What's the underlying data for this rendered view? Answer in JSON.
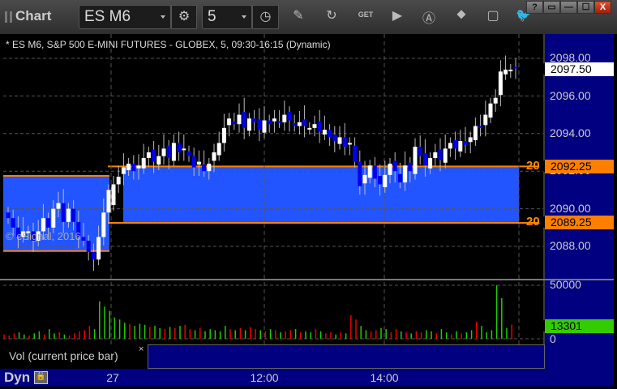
{
  "titlebar": {
    "title": "Chart",
    "symbol": "ES M6",
    "interval": "5",
    "tools": [
      "gear-icon",
      "clock-icon",
      "pencil-icon",
      "refresh-chart-icon",
      "get-icon",
      "play-icon",
      "a-circle-icon",
      "link-icon",
      "comment-icon",
      "twitter-icon"
    ],
    "window_buttons": [
      "?",
      "▭",
      "—",
      "☐",
      "X"
    ]
  },
  "chart": {
    "header": "* ES M6, S&P 500 E-MINI FUTURES - GLOBEX, 5, 09:30-16:15 (Dynamic)",
    "copyright": "© eSignal, 2016",
    "price_labels": [
      "2098.00",
      "2096.00",
      "2094.00",
      "2092.00",
      "2090.00",
      "2088.00"
    ],
    "last_price": "2097.50",
    "level_high": "2092.25",
    "level_low": "2089.25",
    "level_cut_label": "20",
    "colors": {
      "up": "#ffffff",
      "down": "#0000ee",
      "range_fill": "#2255ff",
      "level": "#ff8000",
      "axis": "#000080",
      "vol_up": "#22cc00",
      "vol_down": "#ee0000"
    },
    "prev_day_range": [
      2087.75,
      2091.75
    ],
    "prev_day_closes": [
      2089.5,
      2089,
      2088.5,
      2088.8,
      2088.8,
      2088.3,
      2088.8,
      2089.5,
      2089,
      2090,
      2090.3,
      2089.3,
      2090,
      2089.3,
      2088.5,
      2088.3,
      2087.7,
      2087.3,
      2088.5,
      2089.8,
      2091
    ],
    "day_closes": [
      2091.3,
      2091.7,
      2092.2,
      2092.4,
      2092.0,
      2092.3,
      2092.7,
      2093.0,
      2092.5,
      2092.8,
      2093.2,
      2092.7,
      2093.5,
      2093.0,
      2093.2,
      2092.8,
      2092.2,
      2092.5,
      2092.0,
      2092.4,
      2093.0,
      2093.5,
      2094.3,
      2094.8,
      2094.5,
      2095.0,
      2094.3,
      2094.8,
      2094.6,
      2094.2,
      2094.7,
      2094.5,
      2094.8,
      2094.6,
      2095.0,
      2094.7,
      2094.4,
      2094.6,
      2094.4,
      2094.3,
      2094.5,
      2094.1,
      2094.2,
      2093.8,
      2093.6,
      2093.8,
      2093.3,
      2093.5,
      2092.5,
      2091.2,
      2091.8,
      2092.3,
      2091.6,
      2091.3,
      2091.8,
      2092.4,
      2092.0,
      2091.4,
      2092.3,
      2092.0,
      2093.3,
      2092.8,
      2092.3,
      2092.7,
      2093.0,
      2092.6,
      2093.2,
      2093.5,
      2093.2,
      2093.6,
      2093.4,
      2093.8,
      2094.4,
      2094.3,
      2095.0,
      2095.6,
      2095.9,
      2097.3,
      2097.4,
      2097.4,
      2097.5
    ]
  },
  "volume": {
    "label": "Vol (current price bar)",
    "close_label": "×",
    "scale_labels": [
      "50000",
      "0"
    ],
    "last": "13301",
    "values": [
      4000,
      3000,
      5000,
      6000,
      4000,
      3000,
      5000,
      7000,
      4000,
      9000,
      5000,
      6000,
      4000,
      3000,
      5000,
      7000,
      8000,
      12000,
      9000,
      35000,
      30000,
      26000,
      20000,
      18000,
      15000,
      14000,
      12000,
      14000,
      13000,
      11000,
      12000,
      10000,
      9000,
      11000,
      10000,
      12000,
      13000,
      9000,
      8000,
      10000,
      7000,
      9000,
      8000,
      7000,
      12000,
      9000,
      8000,
      10000,
      8000,
      11000,
      9000,
      8000,
      7000,
      9000,
      8000,
      6000,
      7000,
      8000,
      9000,
      6000,
      7000,
      6000,
      9000,
      7000,
      5000,
      6000,
      4000,
      6000,
      5000,
      22000,
      18000,
      12000,
      8000,
      7000,
      8000,
      10000,
      9000,
      6000,
      9000,
      7000,
      6000,
      5000,
      7000,
      6000,
      8000,
      7000,
      5000,
      9000,
      6000,
      4000,
      7000,
      5000,
      6000,
      8000,
      16000,
      12000,
      6000,
      8000,
      50000,
      38000,
      10000,
      13301
    ]
  },
  "time_axis": {
    "mode": "Dyn",
    "labels": [
      "27",
      "12:00",
      "14:00"
    ]
  }
}
